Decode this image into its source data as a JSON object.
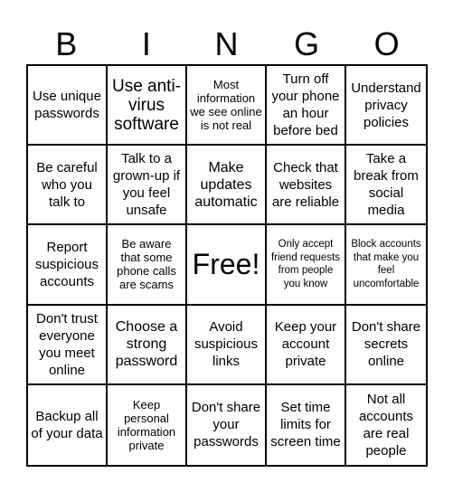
{
  "header": {
    "letters": [
      "B",
      "I",
      "N",
      "G",
      "O"
    ]
  },
  "board": {
    "rows": [
      [
        "Use unique passwords",
        "Use anti-virus software",
        "Most information we see online is not real",
        "Turn off your phone an hour before bed",
        "Understand privacy policies"
      ],
      [
        "Be careful who you talk to",
        "Talk to a grown-up if you feel unsafe",
        "Make updates automatic",
        "Check that websites are reliable",
        "Take a break from social media"
      ],
      [
        "Report suspicious accounts",
        "Be aware that some phone calls are scams",
        "Free!",
        "Only accept friend requests from people you know",
        "Block accounts that make you feel uncomfortable"
      ],
      [
        "Don't trust everyone you meet online",
        "Choose a strong password",
        "Avoid suspicious links",
        "Keep your account private",
        "Don't share secrets online"
      ],
      [
        "Backup all of your data",
        "Keep personal information private",
        "Don't share your passwords",
        "Set time limits for screen time",
        "Not all accounts are real people"
      ]
    ]
  }
}
